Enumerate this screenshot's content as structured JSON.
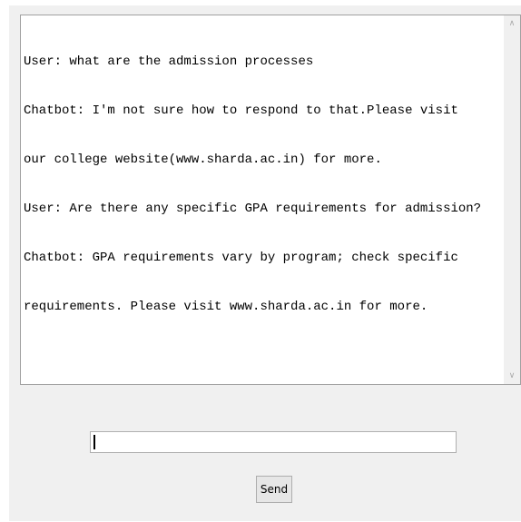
{
  "chat": {
    "lines": [
      "User: what are the admission processes",
      "Chatbot: I'm not sure how to respond to that.Please visit",
      "our college website(www.sharda.ac.in) for more.",
      "User: Are there any specific GPA requirements for admission?",
      "Chatbot: GPA requirements vary by program; check specific",
      "requirements. Please visit www.sharda.ac.in for more."
    ]
  },
  "scrollbar": {
    "up_icon": "chevron-up-icon",
    "down_icon": "chevron-down-icon"
  },
  "input": {
    "value": ""
  },
  "send_button": {
    "label": "Send"
  },
  "colors": {
    "window_background": "#f0f0f0",
    "text": "#000000"
  }
}
